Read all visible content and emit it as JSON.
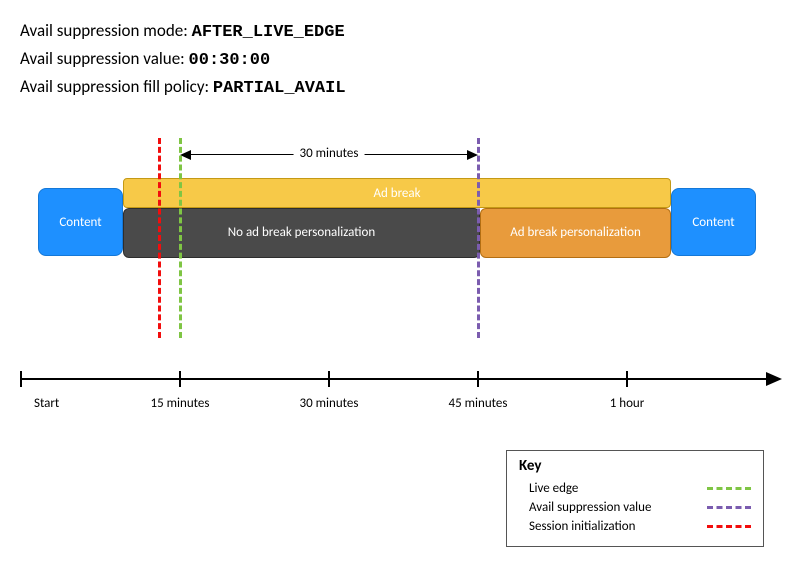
{
  "config": {
    "mode_label": "Avail suppression mode: ",
    "mode_value": "AFTER_LIVE_EDGE",
    "value_label": "Avail suppression value: ",
    "value_value": "00:30:00",
    "policy_label": "Avail suppression fill policy: ",
    "policy_value": "PARTIAL_AVAIL"
  },
  "span": {
    "label": "30 minutes"
  },
  "boxes": {
    "content_left": "Content",
    "ad_break": "Ad break",
    "no_personalization": "No ad break personalization",
    "personalization": "Ad break personalization",
    "content_right": "Content"
  },
  "axis": {
    "start": "Start",
    "ticks": [
      "15 minutes",
      "30 minutes",
      "45 minutes",
      "1 hour"
    ]
  },
  "legend": {
    "title": "Key",
    "items": [
      {
        "label": "Live edge",
        "color": "#7fc544"
      },
      {
        "label": "Avail suppression value",
        "color": "#7b5caf"
      },
      {
        "label": "Session initialization",
        "color": "#f20d0d"
      }
    ]
  }
}
